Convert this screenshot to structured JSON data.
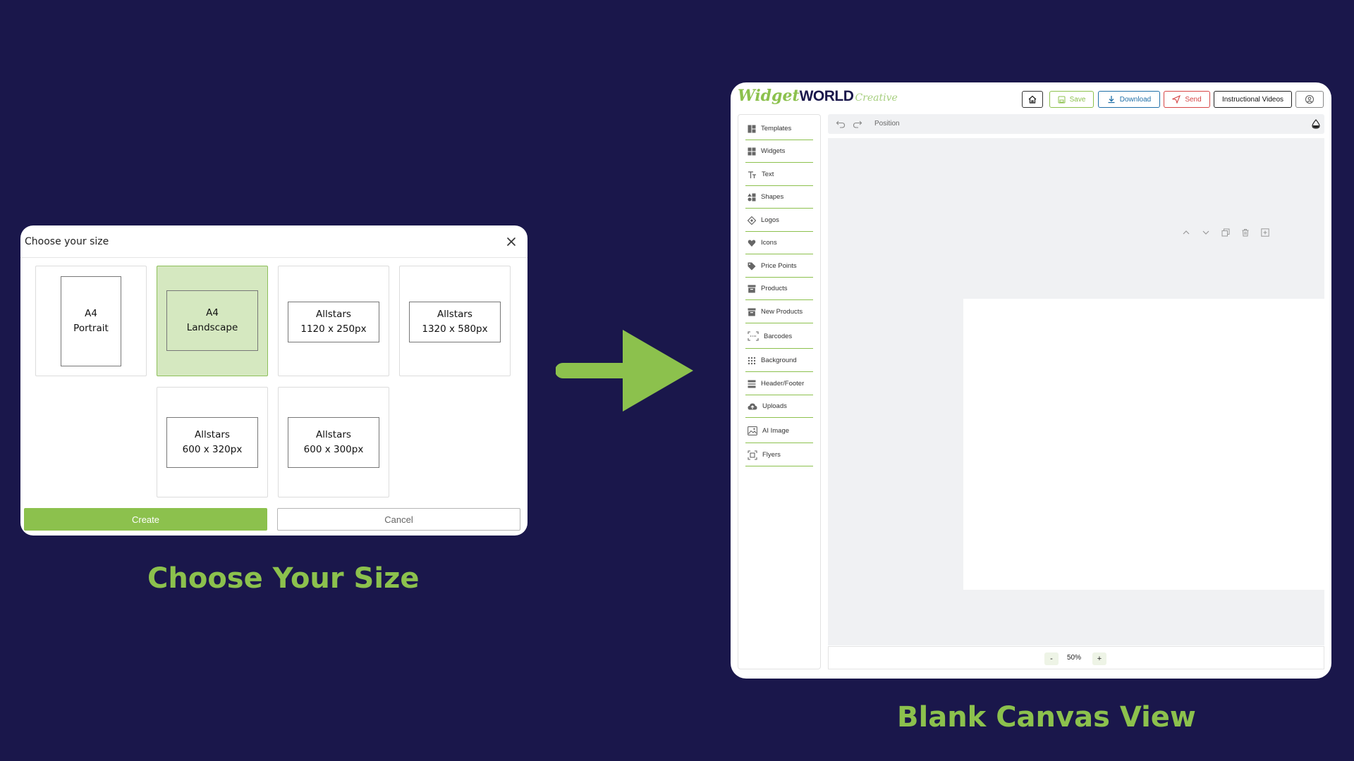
{
  "dialog": {
    "title": "Choose your size",
    "options": [
      {
        "line1": "A4",
        "line2": "Portrait"
      },
      {
        "line1": "A4",
        "line2": "Landscape"
      },
      {
        "line1": "Allstars",
        "line2": "1120 x 250px"
      },
      {
        "line1": "Allstars",
        "line2": "1320 x 580px"
      },
      {
        "line1": "Allstars",
        "line2": "600 x 320px"
      },
      {
        "line1": "Allstars",
        "line2": "600 x 300px"
      }
    ],
    "selected_option": "A4 Landscape",
    "create_label": "Create",
    "cancel_label": "Cancel"
  },
  "captions": {
    "left": "Choose Your Size",
    "right": "Blank Canvas View"
  },
  "editor": {
    "logo": {
      "part1": "Widget",
      "part2": "WORLD",
      "part3": "Creative"
    },
    "toolbar": {
      "save": "Save",
      "download": "Download",
      "send": "Send",
      "videos": "Instructional Videos"
    },
    "sidebar": [
      {
        "label": "Templates",
        "icon": "templates-icon"
      },
      {
        "label": "Widgets",
        "icon": "widgets-icon"
      },
      {
        "label": "Text",
        "icon": "text-icon"
      },
      {
        "label": "Shapes",
        "icon": "shapes-icon"
      },
      {
        "label": "Logos",
        "icon": "logos-icon"
      },
      {
        "label": "Icons",
        "icon": "icons-icon"
      },
      {
        "label": "Price Points",
        "icon": "tag-icon"
      },
      {
        "label": "Products",
        "icon": "products-icon"
      },
      {
        "label": "New Products",
        "icon": "new-products-icon"
      },
      {
        "label": "Barcodes",
        "icon": "barcode-icon"
      },
      {
        "label": "Background",
        "icon": "background-icon"
      },
      {
        "label": "Header/Footer",
        "icon": "header-footer-icon"
      },
      {
        "label": "Uploads",
        "icon": "upload-icon"
      },
      {
        "label": "AI Image",
        "icon": "image-icon"
      },
      {
        "label": "Flyers",
        "icon": "flyers-icon"
      }
    ],
    "position_label": "Position",
    "zoom": {
      "minus": "-",
      "value": "50%",
      "plus": "+"
    }
  },
  "colors": {
    "background": "#1a174b",
    "accent_green": "#8cc14d",
    "selected_fill": "#d5e8c0",
    "download_blue": "#1f6fa8",
    "send_red": "#d64545"
  }
}
